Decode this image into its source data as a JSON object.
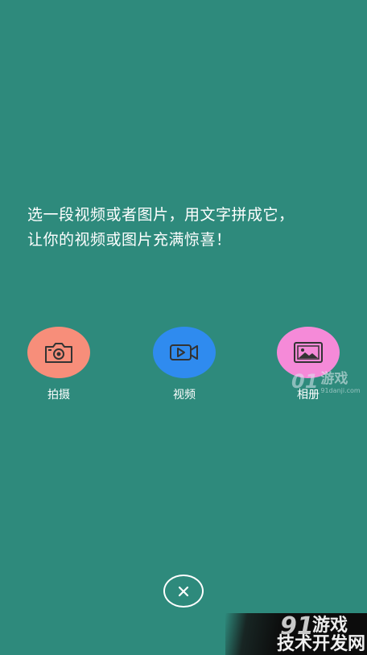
{
  "intro": {
    "line1": "选一段视频或者图片，用文字拼成它，",
    "line2": "让你的视频或图片充满惊喜！"
  },
  "options": [
    {
      "label": "拍摄",
      "icon": "camera-icon",
      "color": "#f78e7a"
    },
    {
      "label": "视频",
      "icon": "video-icon",
      "color": "#2f8bef"
    },
    {
      "label": "相册",
      "icon": "album-icon",
      "color": "#f58ad8"
    }
  ],
  "close": {
    "icon": "close-icon"
  },
  "watermark_mid": {
    "brand": "01",
    "title": "游戏",
    "domain": "91danji.com"
  },
  "watermark_corner": {
    "brand": "91",
    "title": "游戏",
    "tag": "技术开发网"
  },
  "colors": {
    "background": "#2e8a7c",
    "text": "#ffffff"
  }
}
